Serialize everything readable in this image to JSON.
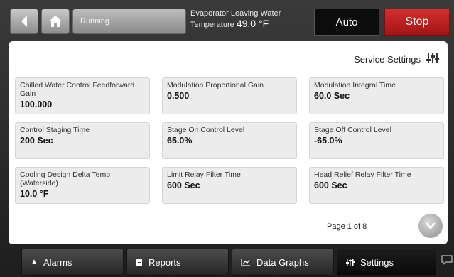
{
  "header": {
    "status": "Running",
    "evap_label": "Evaporator Leaving Water",
    "evap_temp_prefix": "Temperature",
    "evap_temp_value": "49.0 °F",
    "auto_label": "Auto",
    "stop_label": "Stop"
  },
  "panel": {
    "title": "Service Settings",
    "page": "Page 1 of 8",
    "settings": [
      {
        "label": "Chilled Water Control Feedforward Gain",
        "value": "100.000"
      },
      {
        "label": "Modulation Proportional Gain",
        "value": "0.500"
      },
      {
        "label": "Modulation Integral Time",
        "value": "60.0 Sec"
      },
      {
        "label": "Control Staging Time",
        "value": "200 Sec"
      },
      {
        "label": "Stage On Control Level",
        "value": "65.0%"
      },
      {
        "label": "Stage Off Control Level",
        "value": "-65.0%"
      },
      {
        "label": "Cooling Design Delta Temp (Waterside)",
        "value": "10.0 °F"
      },
      {
        "label": "Limit Relay Filter Time",
        "value": "600 Sec"
      },
      {
        "label": "Head Relief Relay Filter Time",
        "value": "600 Sec"
      }
    ]
  },
  "tabs": {
    "alarms": "Alarms",
    "reports": "Reports",
    "graphs": "Data Graphs",
    "settings": "Settings"
  },
  "colors": {
    "stop": "#c21d1d",
    "tile": "#ececec",
    "panel": "#ffffff"
  },
  "icons": [
    "back-arrow-icon",
    "home-icon",
    "settings-sliders-icon",
    "chevron-down-icon",
    "alarm-bell-icon",
    "reports-document-icon",
    "graph-icon",
    "chat-icon"
  ]
}
